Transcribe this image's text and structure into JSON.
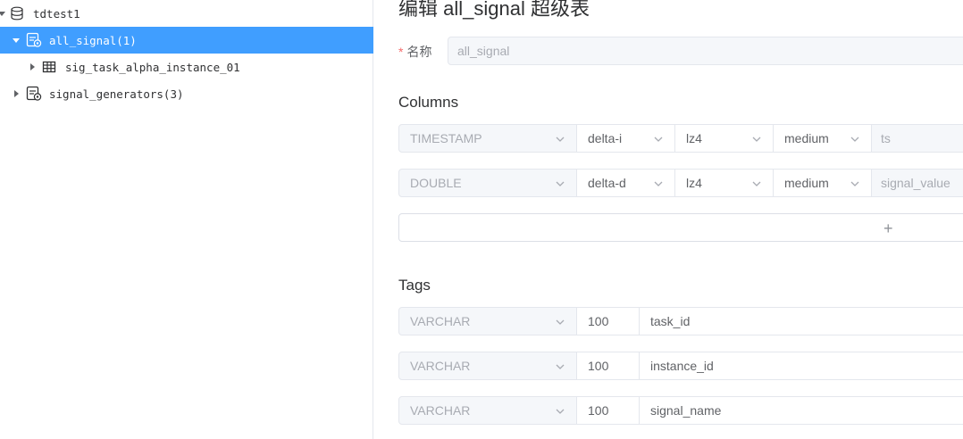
{
  "tree": {
    "database": {
      "label": "tdtest1",
      "icon": "database-icon"
    },
    "stable_selected": {
      "label": "all_signal(1)",
      "icon": "supertable-icon"
    },
    "child_table": {
      "label": "sig_task_alpha_instance_01",
      "icon": "table-icon"
    },
    "stable_other": {
      "label": "signal_generators(3)",
      "icon": "supertable-icon"
    }
  },
  "form": {
    "title": "编辑 all_signal 超级表",
    "name_required_mark": "*",
    "name_label": "名称",
    "name_value": "all_signal",
    "columns_heading": "Columns",
    "tags_heading": "Tags",
    "add_symbol": "+"
  },
  "columns": [
    {
      "type": "TIMESTAMP",
      "encode": "delta-i",
      "compress": "lz4",
      "level": "medium",
      "name": "ts"
    },
    {
      "type": "DOUBLE",
      "encode": "delta-d",
      "compress": "lz4",
      "level": "medium",
      "name": "signal_value"
    }
  ],
  "tags": [
    {
      "type": "VARCHAR",
      "length": "100",
      "name": "task_id"
    },
    {
      "type": "VARCHAR",
      "length": "100",
      "name": "instance_id"
    },
    {
      "type": "VARCHAR",
      "length": "100",
      "name": "signal_name"
    }
  ],
  "colors": {
    "accent": "#409eff",
    "required": "#f56c6c",
    "border": "#e4e7ed",
    "disabled_bg": "#f5f7fa"
  }
}
